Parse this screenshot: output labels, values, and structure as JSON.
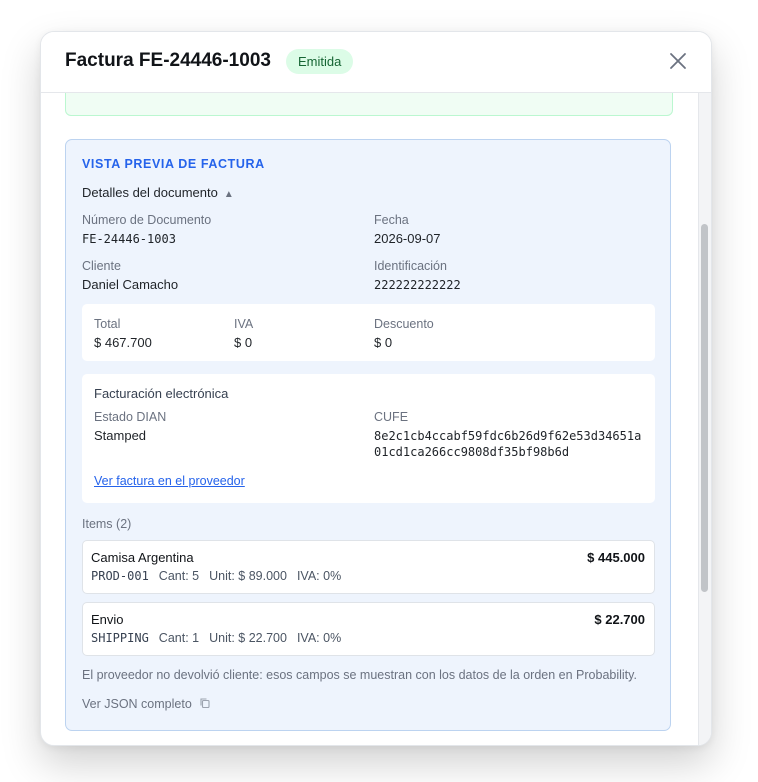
{
  "modal": {
    "title": "Factura FE-24446-1003",
    "status_badge": "Emitida"
  },
  "preview": {
    "section_title": "VISTA PREVIA DE FACTURA",
    "details_toggle": "Detalles del documento",
    "doc_number_label": "Número de Documento",
    "doc_number": "FE-24446-1003",
    "date_label": "Fecha",
    "date": "2026-09-07",
    "client_label": "Cliente",
    "client": "Daniel Camacho",
    "id_label": "Identificación",
    "id_value": "222222222222",
    "totals": {
      "total_label": "Total",
      "total": "$ 467.700",
      "iva_label": "IVA",
      "iva": "$ 0",
      "discount_label": "Descuento",
      "discount": "$ 0"
    },
    "e_invoice": {
      "title": "Facturación electrónica",
      "dian_label": "Estado DIAN",
      "dian_status": "Stamped",
      "cufe_label": "CUFE",
      "cufe_line1": "8e2c1cb4ccabf59fdc6b26d9f62e53d34651a",
      "cufe_line2": "01cd1ca266cc9808df35bf98b6d",
      "provider_link": "Ver factura en el proveedor"
    },
    "items_label": "Items (2)",
    "items": [
      {
        "name": "Camisa Argentina",
        "price": "$ 445.000",
        "code": "PROD-001",
        "qty": "Cant: 5",
        "unit": "Unit: $ 89.000",
        "iva": "IVA: 0%"
      },
      {
        "name": "Envio",
        "price": "$ 22.700",
        "code": "SHIPPING",
        "qty": "Cant: 1",
        "unit": "Unit: $ 22.700",
        "iva": "IVA: 0%"
      }
    ],
    "note": "El proveedor no devolvió cliente: esos campos se muestran con los datos de la orden en Probability.",
    "json_link": "Ver JSON completo"
  },
  "colors": {
    "accent": "#2563eb",
    "badge_bg": "#dcfce7",
    "badge_text": "#166534",
    "preview_bg": "#eef4fd"
  },
  "icons": {
    "close": "close-icon",
    "copy": "copy-icon",
    "toggle": "triangle-up-icon"
  }
}
